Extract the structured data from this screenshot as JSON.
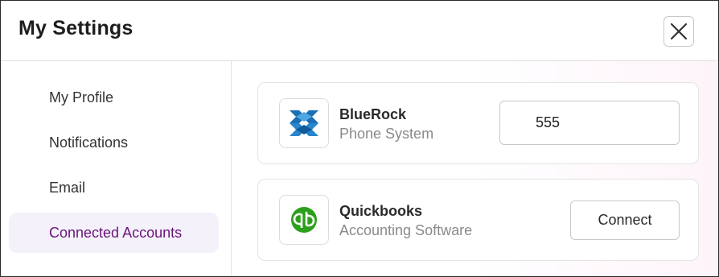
{
  "header": {
    "title": "My Settings",
    "close_icon": "close-icon"
  },
  "sidebar": {
    "items": [
      {
        "label": "My Profile",
        "active": false
      },
      {
        "label": "Notifications",
        "active": false
      },
      {
        "label": "Email",
        "active": false
      },
      {
        "label": "Connected Accounts",
        "active": true
      }
    ]
  },
  "accounts": [
    {
      "name": "BlueRock",
      "type": "Phone System",
      "logo_icon": "bluerock-logo-icon",
      "extension_value": "555",
      "brand_color": "#1a6fb5"
    },
    {
      "name": "Quickbooks",
      "type": "Accounting Software",
      "logo_icon": "quickbooks-logo-icon",
      "connect_label": "Connect",
      "brand_color": "#2ca01c"
    }
  ],
  "colors": {
    "accent": "#6a1577",
    "active_bg": "#f4f1fb",
    "muted_text": "#8a8a8a"
  }
}
